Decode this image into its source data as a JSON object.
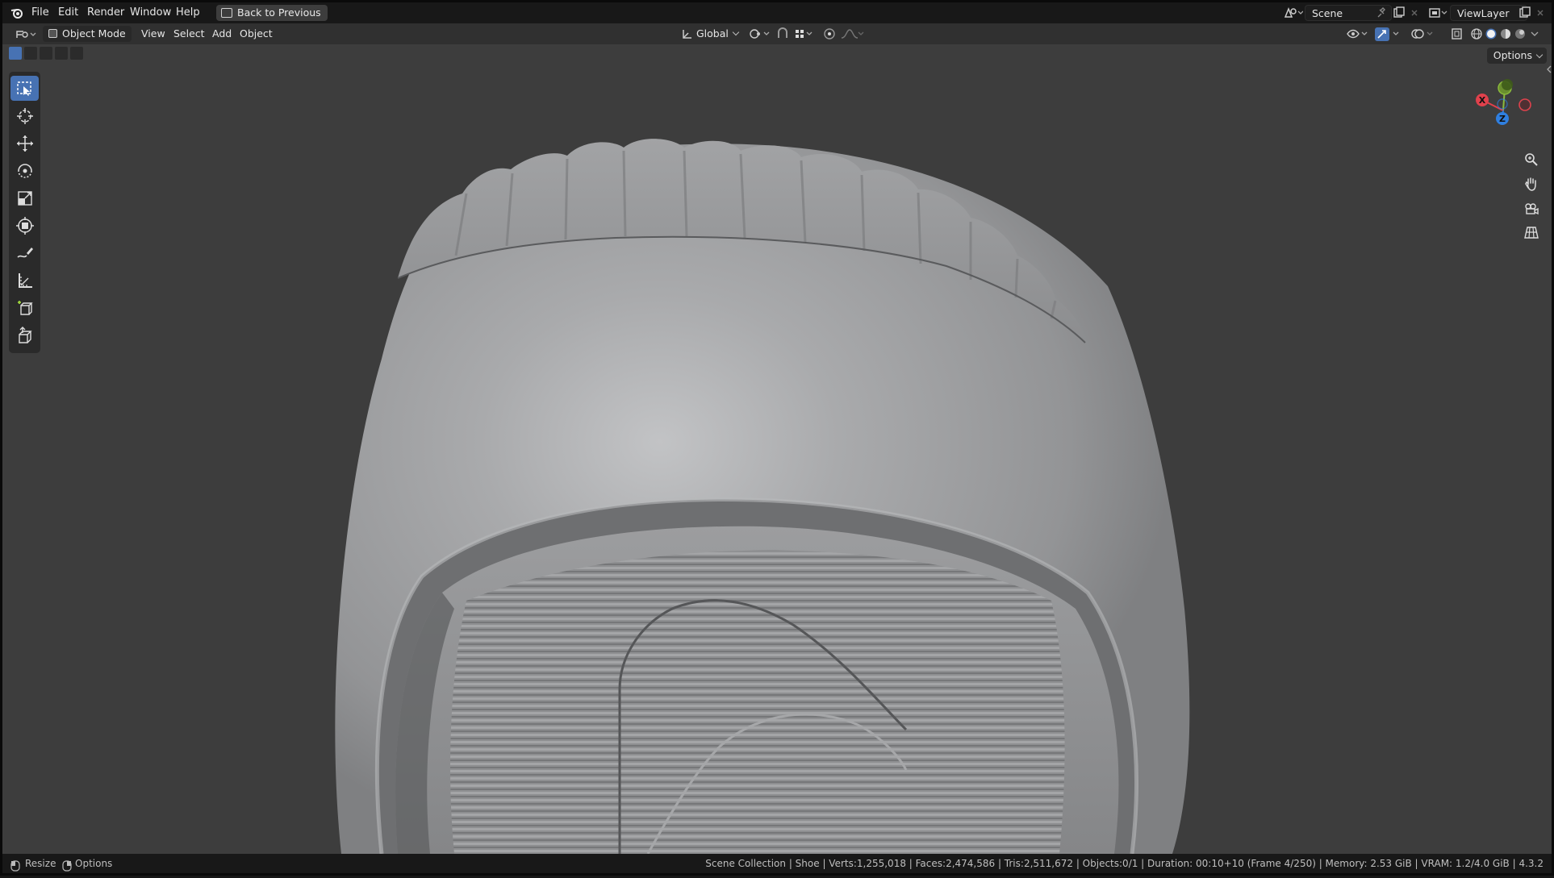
{
  "menu": {
    "file": "File",
    "edit": "Edit",
    "render": "Render",
    "window": "Window",
    "help": "Help"
  },
  "back_button": "Back to Previous",
  "scene": {
    "name": "Scene"
  },
  "view_layer": {
    "name": "ViewLayer"
  },
  "header": {
    "mode": "Object Mode",
    "view": "View",
    "select": "Select",
    "add": "Add",
    "object": "Object",
    "orientation": "Global",
    "options": "Options"
  },
  "gizmo": {
    "x": "X",
    "y": "Y",
    "z": "Z"
  },
  "status": {
    "left_action": "Resize",
    "left_options": "Options",
    "info": "Scene Collection | Shoe | Verts:1,255,018 | Faces:2,474,586 | Tris:2,511,672 | Objects:0/1 | Duration: 00:10+10 (Frame 4/250) | Memory: 2.53 GiB | VRAM: 1.2/4.0 GiB | 4.3.2"
  },
  "colors": {
    "accent": "#4772b3",
    "axis_x": "#e0414c",
    "axis_y": "#8bba3c",
    "axis_z": "#2f7fe0",
    "viewport_bg": "#3d3d3d"
  }
}
